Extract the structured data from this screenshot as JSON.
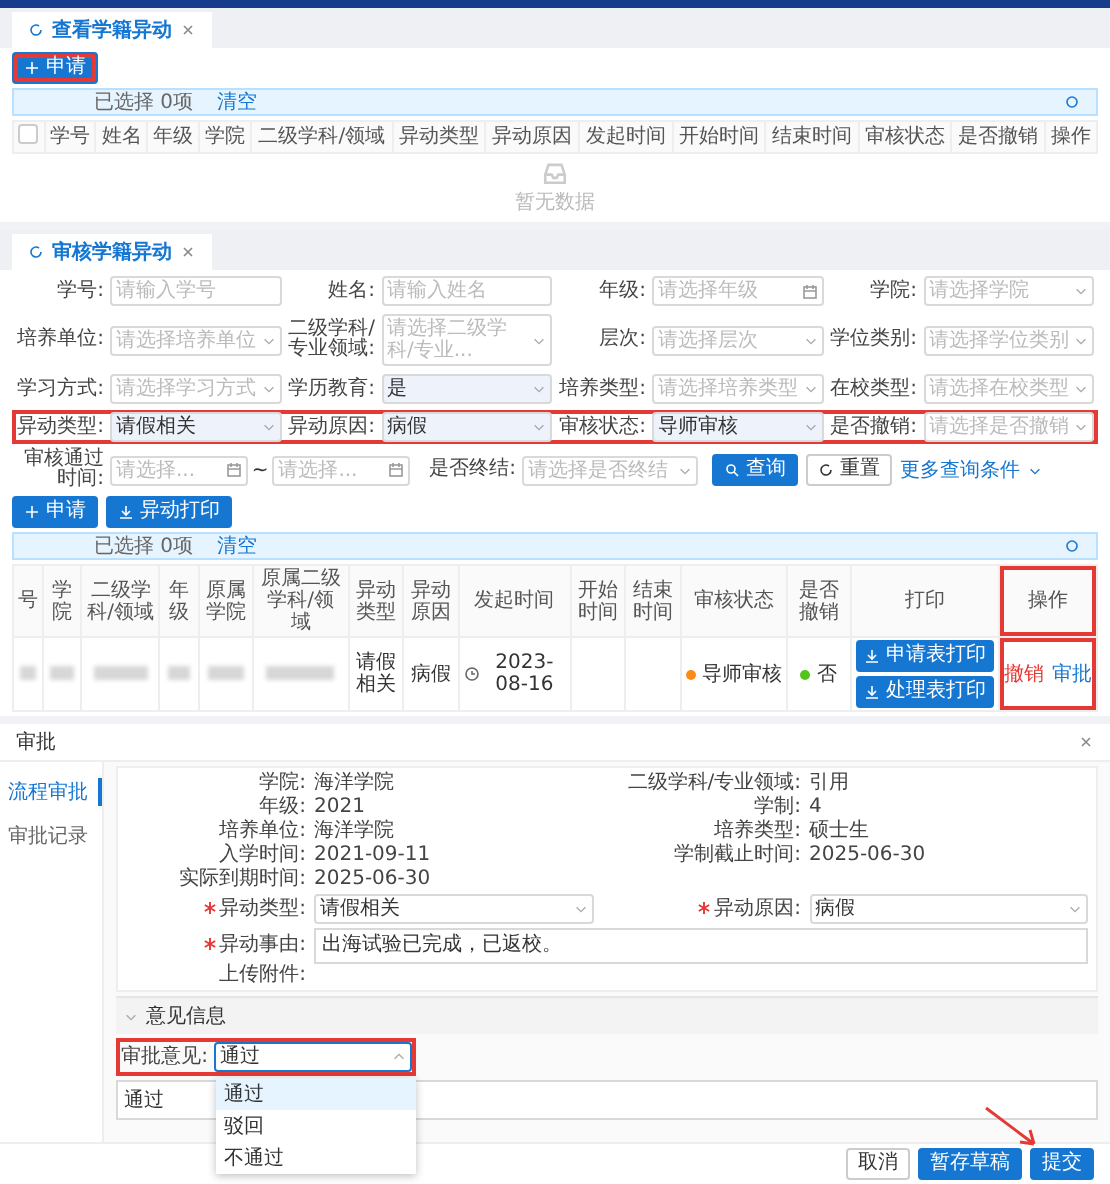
{
  "view_panel": {
    "tab": {
      "label": "查看学籍异动",
      "selected": true
    },
    "apply_button": {
      "label": "申请",
      "highlighted": true
    },
    "selection": {
      "text": "已选择 0项",
      "clear": "清空"
    },
    "table": {
      "select_all": {
        "checked": false
      },
      "columns": [
        "学号",
        "姓名",
        "年级",
        "学院",
        "二级学科/领域",
        "异动类型",
        "异动原因",
        "发起时间",
        "开始时间",
        "结束时间",
        "审核状态",
        "是否撤销",
        "操作"
      ],
      "empty_text": "暂无数据"
    }
  },
  "review_panel": {
    "tab": {
      "label": "审核学籍异动",
      "selected": true
    },
    "filter_rows": [
      {
        "highlighted": false,
        "fields": [
          {
            "kind": "input",
            "label": "学号:",
            "placeholder": "请输入学号"
          },
          {
            "kind": "input",
            "label": "姓名:",
            "placeholder": "请输入姓名"
          },
          {
            "kind": "date",
            "label": "年级:",
            "placeholder": "请选择年级"
          },
          {
            "kind": "select",
            "label": "学院:",
            "placeholder": "请选择学院"
          }
        ]
      },
      {
        "highlighted": false,
        "fields": [
          {
            "kind": "select",
            "label": "培养单位:",
            "placeholder": "请选择培养单位"
          },
          {
            "kind": "select",
            "label": "二级学科/专业领域:",
            "placeholder": "请选择二级学科/专业..."
          },
          {
            "kind": "select",
            "label": "层次:",
            "placeholder": "请选择层次"
          },
          {
            "kind": "select",
            "label": "学位类别:",
            "placeholder": "请选择学位类别"
          }
        ]
      },
      {
        "highlighted": false,
        "fields": [
          {
            "kind": "select",
            "label": "学习方式:",
            "placeholder": "请选择学习方式"
          },
          {
            "kind": "select",
            "label": "学历教育:",
            "value": "是"
          },
          {
            "kind": "select",
            "label": "培养类型:",
            "placeholder": "请选择培养类型"
          },
          {
            "kind": "select",
            "label": "在校类型:",
            "placeholder": "请选择在校类型"
          }
        ]
      },
      {
        "highlighted": true,
        "fields": [
          {
            "kind": "select",
            "label": "异动类型:",
            "value": "请假相关"
          },
          {
            "kind": "select",
            "label": "异动原因:",
            "value": "病假"
          },
          {
            "kind": "select",
            "label": "审核状态:",
            "value": "导师审核"
          },
          {
            "kind": "select",
            "label": "是否撤销:",
            "placeholder": "请选择是否撤销"
          }
        ]
      }
    ],
    "last_row": {
      "range": {
        "label": "审核通过时间:",
        "from": "请选择...",
        "separator": "~",
        "to": "请选择..."
      },
      "end_field": {
        "label": "是否终结:",
        "placeholder": "请选择是否终结"
      },
      "search": "查询",
      "reset": "重置",
      "more": "更多查询条件"
    },
    "actions": [
      {
        "label": "申请",
        "kind": "add"
      },
      {
        "label": "异动打印",
        "kind": "print"
      }
    ],
    "selection": {
      "text": "已选择 0项",
      "clear": "清空"
    },
    "table": {
      "columns": [
        {
          "label": "号",
          "highlighted": false
        },
        {
          "label": "学院",
          "highlighted": false
        },
        {
          "label": "二级学科/领域",
          "highlighted": false
        },
        {
          "label": "年级",
          "highlighted": false
        },
        {
          "label": "原属学院",
          "highlighted": false
        },
        {
          "label": "原属二级学科/领域",
          "highlighted": false
        },
        {
          "label": "异动类型",
          "highlighted": false
        },
        {
          "label": "异动原因",
          "highlighted": false
        },
        {
          "label": "发起时间",
          "highlighted": false
        },
        {
          "label": "开始时间",
          "highlighted": false
        },
        {
          "label": "结束时间",
          "highlighted": false
        },
        {
          "label": "审核状态",
          "highlighted": false
        },
        {
          "label": "是否撤销",
          "highlighted": false
        },
        {
          "label": "打印",
          "highlighted": false
        },
        {
          "label": "操作",
          "highlighted": true
        }
      ],
      "rows": [
        {
          "cells": [
            {
              "kind": "blurred"
            },
            {
              "kind": "blurred"
            },
            {
              "kind": "blurred"
            },
            {
              "kind": "blurred"
            },
            {
              "kind": "blurred"
            },
            {
              "kind": "blurred"
            },
            {
              "kind": "text",
              "text": "请假相关"
            },
            {
              "kind": "text",
              "text": "病假"
            },
            {
              "kind": "date",
              "text": "2023-08-16"
            },
            {
              "kind": "text",
              "text": ""
            },
            {
              "kind": "text",
              "text": ""
            },
            {
              "kind": "status",
              "text": "导师审核",
              "color": "#fa8c16"
            },
            {
              "kind": "status",
              "text": "否",
              "color": "#52c41a"
            },
            {
              "kind": "buttons",
              "buttons": [
                "申请表打印",
                "处理表打印"
              ]
            },
            {
              "kind": "links",
              "highlighted": true,
              "links": [
                {
                  "label": "撤销",
                  "kind": "danger"
                },
                {
                  "label": "审批",
                  "kind": "primary"
                }
              ]
            }
          ]
        }
      ]
    }
  },
  "dialog": {
    "title": "审批",
    "nav": [
      {
        "label": "流程审批",
        "selected": true
      },
      {
        "label": "审批记录",
        "selected": false
      }
    ],
    "info": [
      {
        "label": "学院:",
        "value": "海洋学院"
      },
      {
        "label": "二级学科/专业领域:",
        "value": "引用"
      },
      {
        "label": "年级:",
        "value": "2021"
      },
      {
        "label": "学制:",
        "value": "4"
      },
      {
        "label": "培养单位:",
        "value": "海洋学院"
      },
      {
        "label": "培养类型:",
        "value": "硕士生"
      },
      {
        "label": "入学时间:",
        "value": "2021-09-11"
      },
      {
        "label": "学制截止时间:",
        "value": "2025-06-30"
      },
      {
        "label": "实际到期时间:",
        "value": "2025-06-30"
      }
    ],
    "selects": [
      {
        "label": "异动类型:",
        "required": true,
        "value": "请假相关"
      },
      {
        "label": "异动原因:",
        "required": true,
        "value": "病假"
      }
    ],
    "reason": {
      "label": "异动事由:",
      "required": true,
      "value": "出海试验已完成，已返校。"
    },
    "upload_label": "上传附件:",
    "opinion": {
      "title": "意见信息",
      "expanded": true,
      "highlighted": true,
      "label": "审批意见:",
      "value": "通过",
      "open": true,
      "options": [
        {
          "label": "通过",
          "selected": true
        },
        {
          "label": "驳回",
          "selected": false
        },
        {
          "label": "不通过",
          "selected": false
        }
      ],
      "comment": "通过"
    },
    "footer": [
      {
        "label": "取消",
        "kind": "default",
        "pointed": false
      },
      {
        "label": "暂存草稿",
        "kind": "primary",
        "pointed": false
      },
      {
        "label": "提交",
        "kind": "primary",
        "pointed": true
      }
    ]
  }
}
